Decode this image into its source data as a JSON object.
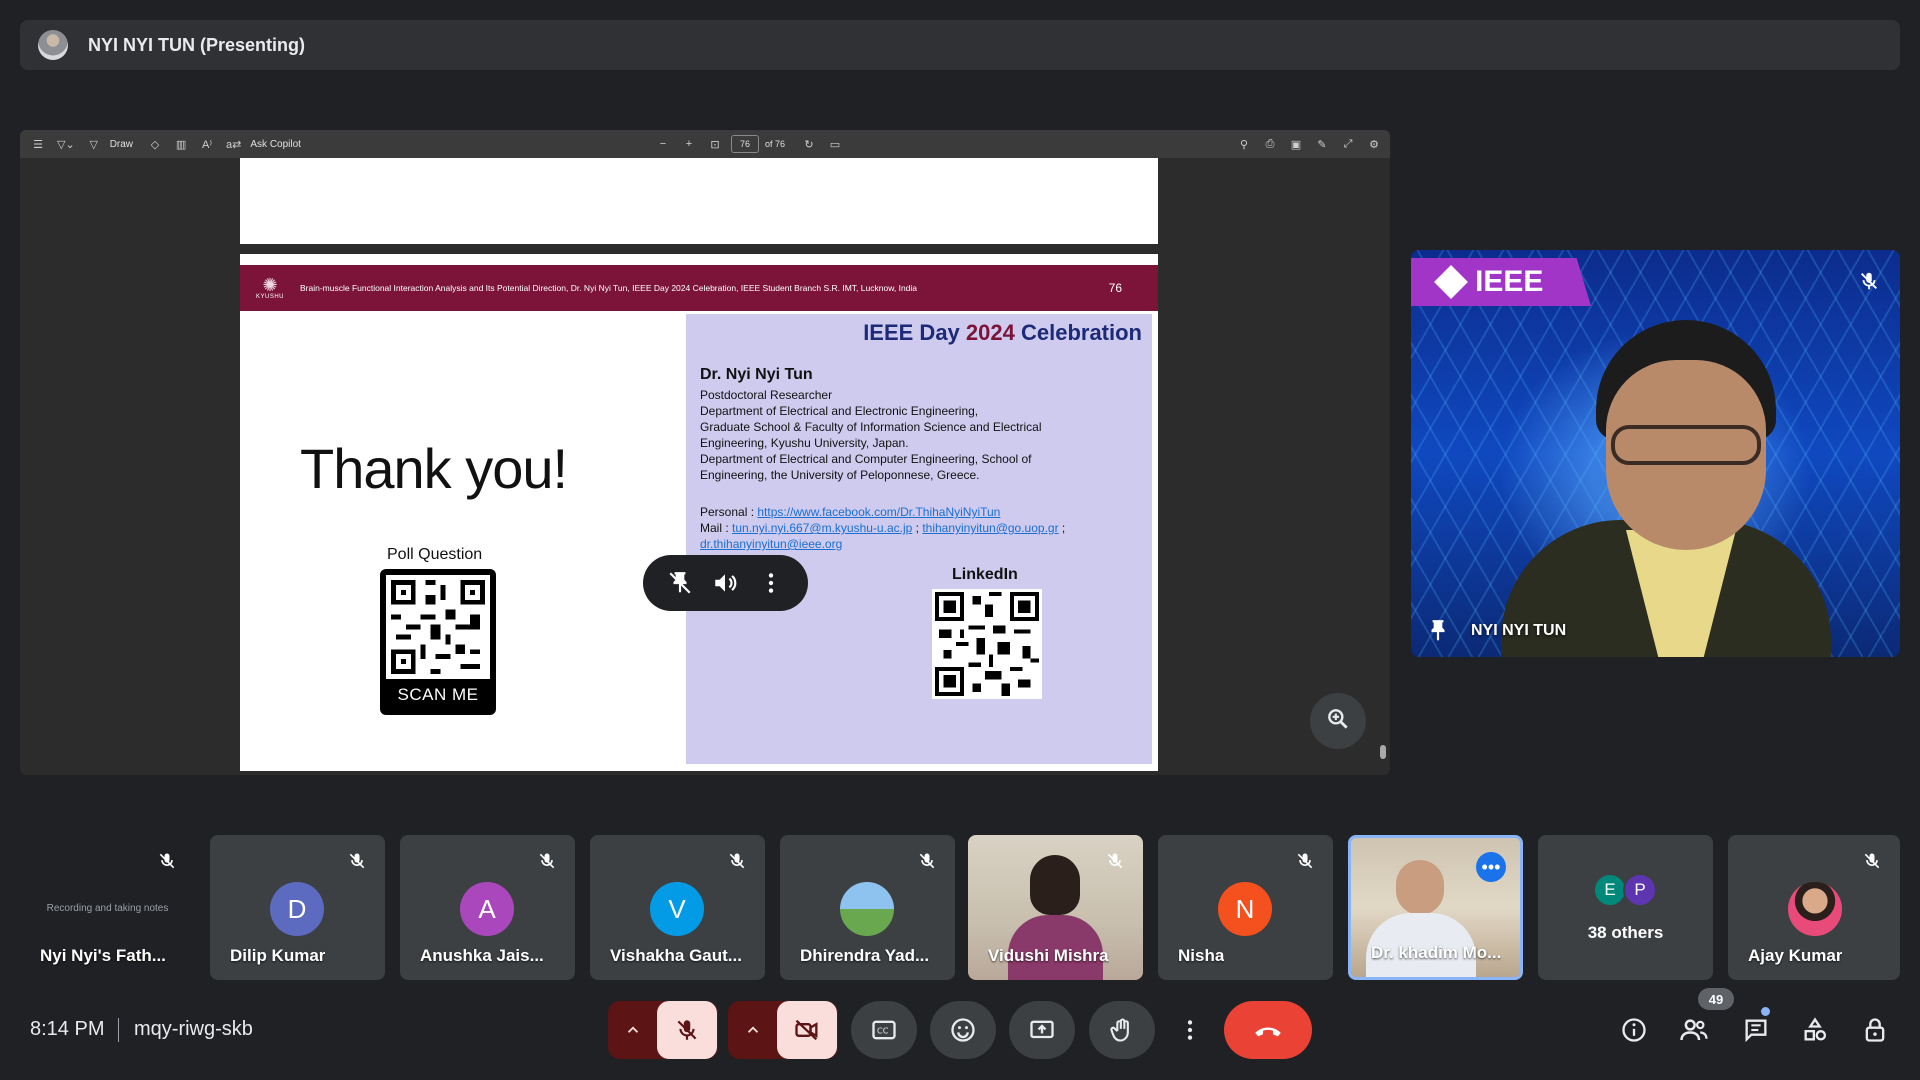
{
  "top_bar": {
    "title": "NYI NYI TUN (Presenting)"
  },
  "pdf_toolbar": {
    "draw_label": "Draw",
    "copilot_label": "Ask Copilot",
    "page_number": "76",
    "page_total": "of 76"
  },
  "slide": {
    "header_text": "Brain-muscle Functional Interaction Analysis and Its Potential Direction, Dr. Nyi Nyi Tun, IEEE Day 2024 Celebration, IEEE Student Branch S.R. IMT, Lucknow, India",
    "slide_number": "76",
    "logo_text": "KYUSHU",
    "thank_you": "Thank you!",
    "poll_title": "Poll Question",
    "scan_me": "SCAN ME",
    "celebration_prefix": "IEEE Day ",
    "celebration_year": "2024",
    "celebration_suffix": " Celebration",
    "presenter_name": "Dr. Nyi Nyi Tun",
    "affiliation_lines": [
      "Postdoctoral Researcher",
      "Department of Electrical and Electronic Engineering,",
      "Graduate School & Faculty of Information Science and Electrical",
      "Engineering, Kyushu University, Japan.",
      "Department of Electrical and Computer Engineering, School of",
      "Engineering, the University of Peloponnese, Greece."
    ],
    "personal_label": "Personal : ",
    "personal_link": "https://www.facebook.com/Dr.ThihaNyiNyiTun",
    "mail_label": "Mail : ",
    "mail_link_1": "tun.nyi.nyi.667@m.kyushu-u.ac.jp",
    "mail_sep_1": " ; ",
    "mail_link_2": "thihanyinyitun@go.uop.gr",
    "mail_sep_2": " ;",
    "mail_link_3": "dr.thihanyinyitun@ieee.org",
    "linkedin_title": "LinkedIn"
  },
  "speaker": {
    "name": "NYI NYI TUN",
    "banner": "IEEE"
  },
  "participants": [
    {
      "name": "Nyi Nyi's Fath...",
      "note": "Recording and taking notes",
      "type": "note"
    },
    {
      "name": "Dilip Kumar",
      "initial": "D",
      "color": "#5c6bc0",
      "type": "initial"
    },
    {
      "name": "Anushka Jais...",
      "initial": "A",
      "color": "#ab47bc",
      "type": "initial"
    },
    {
      "name": "Vishakha Gaut...",
      "initial": "V",
      "color": "#039be5",
      "type": "initial"
    },
    {
      "name": "Dhirendra Yad...",
      "type": "photo"
    },
    {
      "name": "Vidushi Mishra",
      "type": "video"
    },
    {
      "name": "Nisha",
      "initial": "N",
      "color": "#f4511e",
      "type": "initial"
    },
    {
      "name": "Dr. khadim Mo...",
      "type": "video-active"
    },
    {
      "others_label": "38 others",
      "avatars": [
        {
          "initial": "E",
          "color": "#00897b"
        },
        {
          "initial": "P",
          "color": "#5e35b1"
        }
      ],
      "type": "others"
    },
    {
      "name": "Ajay Kumar",
      "type": "photo"
    }
  ],
  "bottom_bar": {
    "time": "8:14 PM",
    "meeting_code": "mqy-riwg-skb",
    "participants_count": "49"
  },
  "colors": {
    "background": "#202124",
    "tile": "#3c4043",
    "slide_header": "#7b1438",
    "info_panel": "#cfcbee",
    "end_call": "#ea4335",
    "mic_off_bg": "#f9dedc"
  }
}
